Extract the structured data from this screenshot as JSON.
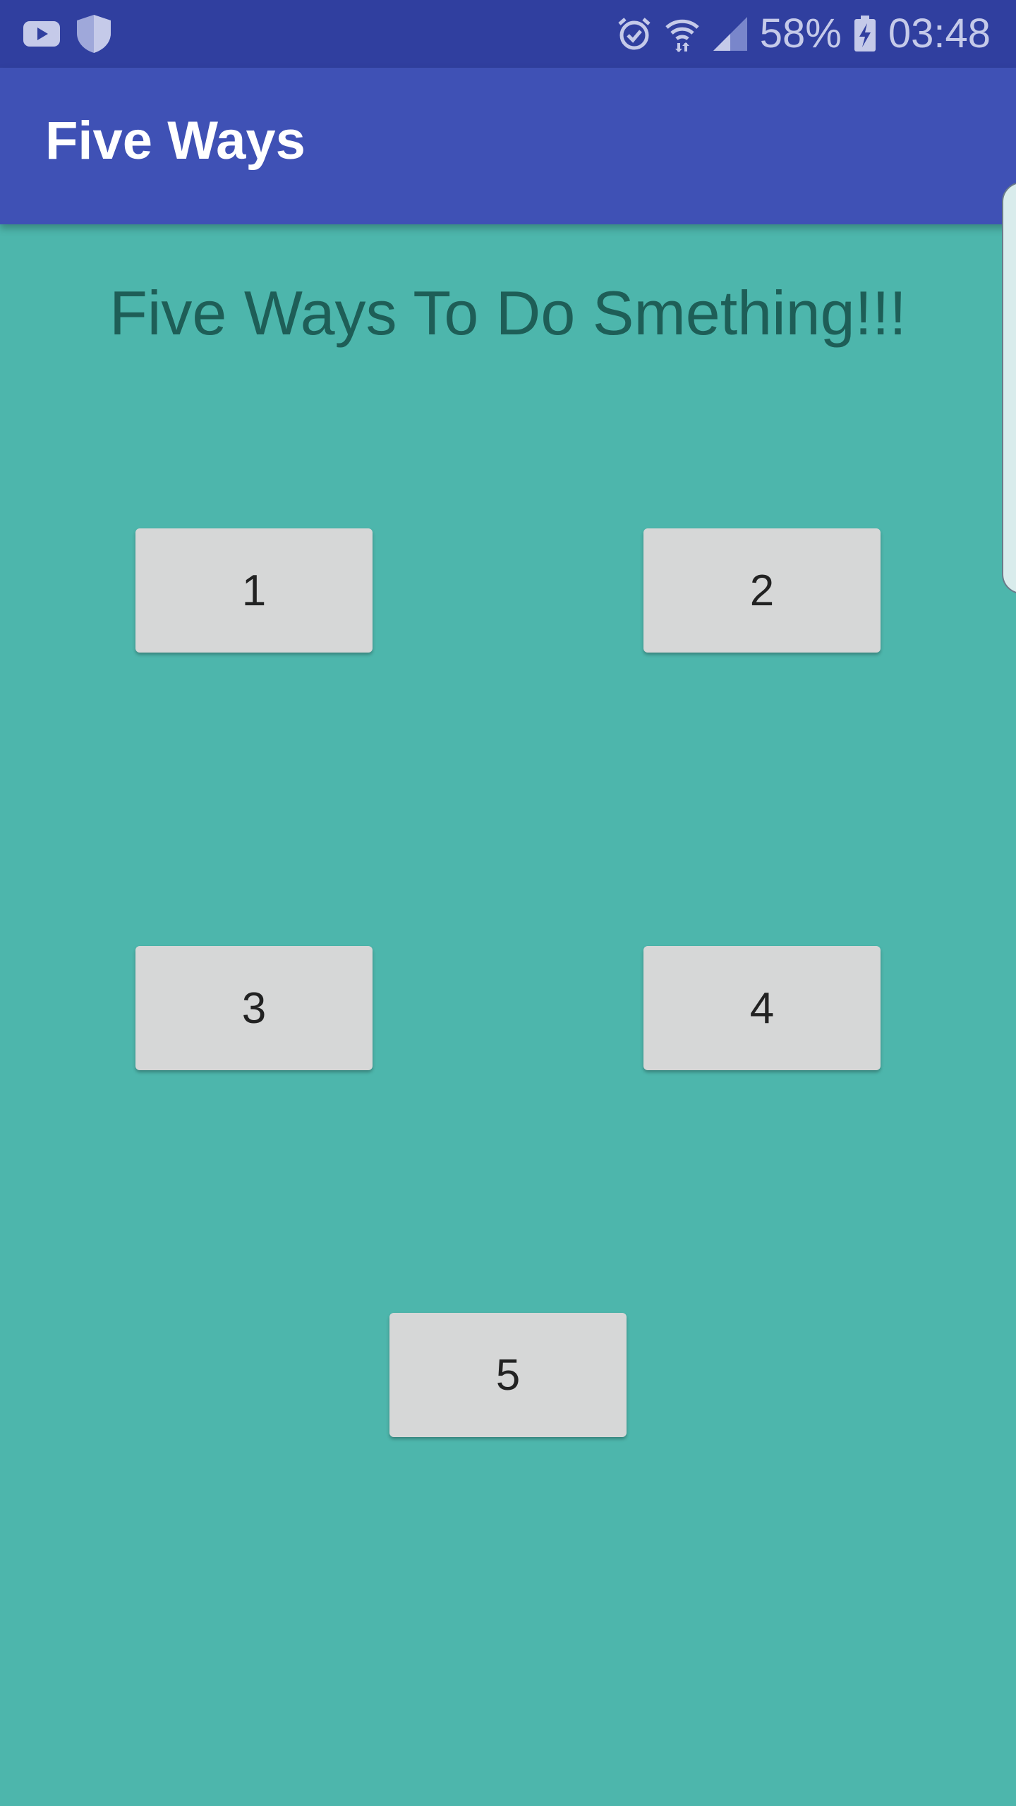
{
  "status_bar": {
    "battery_percent": "58%",
    "time": "03:48",
    "icons": [
      "youtube-icon",
      "shield-icon",
      "alarm-icon",
      "wifi-icon",
      "signal-icon",
      "battery-charging-icon"
    ]
  },
  "app_bar": {
    "title": "Five Ways"
  },
  "main": {
    "headline": "Five Ways To Do Smething!!!",
    "buttons": [
      {
        "label": "1"
      },
      {
        "label": "2"
      },
      {
        "label": "3"
      },
      {
        "label": "4"
      },
      {
        "label": "5"
      }
    ]
  },
  "colors": {
    "status_bar": "#303f9f",
    "app_bar": "#3f51b5",
    "background": "#4db6ac",
    "headline_text": "#1e5e57",
    "button_bg": "#d6d7d7"
  }
}
